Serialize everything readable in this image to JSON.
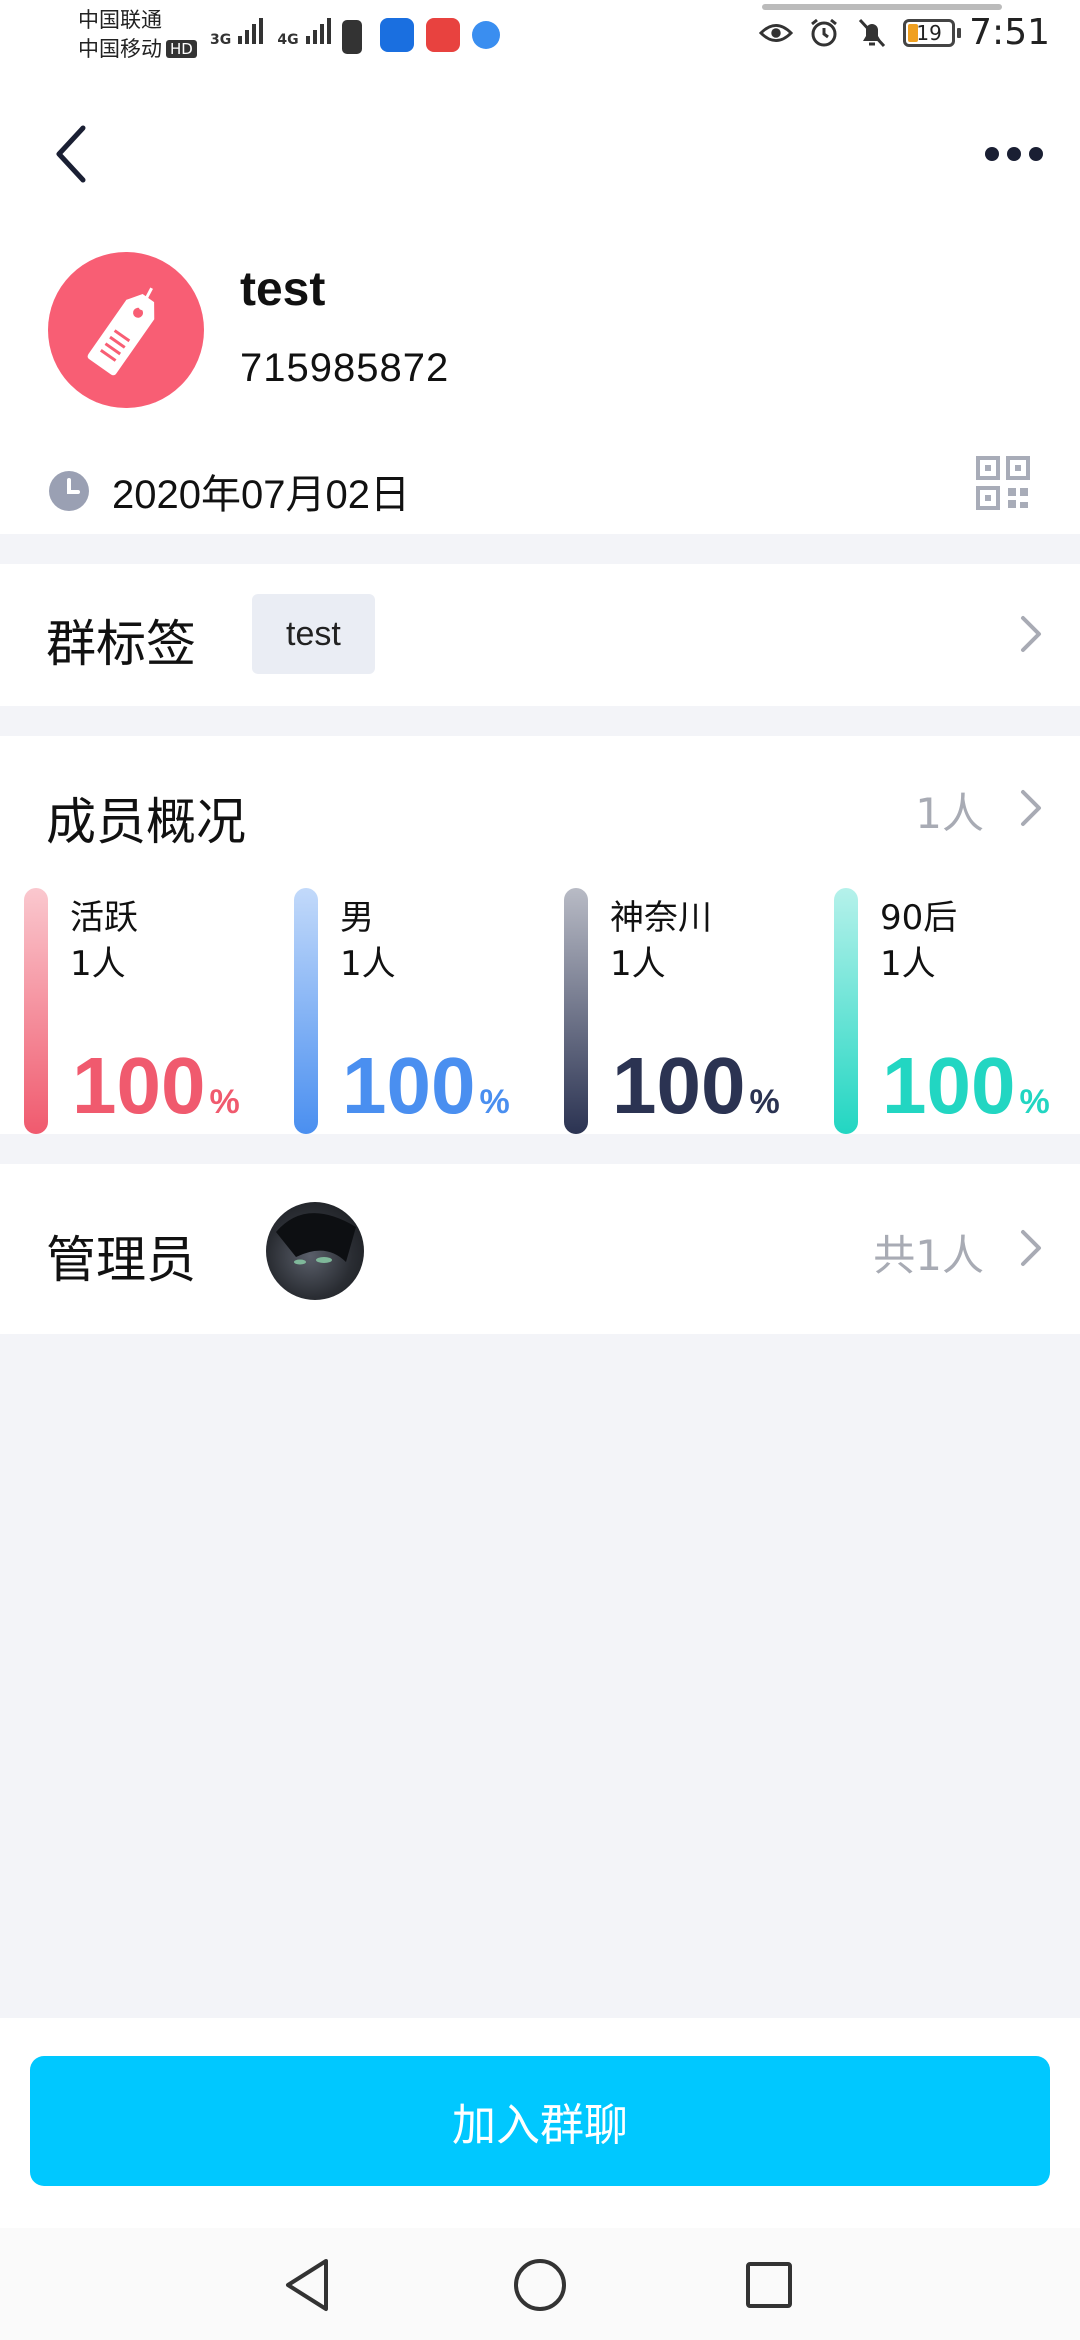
{
  "status_bar": {
    "carrier_1": "中国联通",
    "carrier_2": "中国移动",
    "hd": "HD",
    "net_1": "3G",
    "net_2": "4G",
    "battery": "19",
    "time": "7:51"
  },
  "header": {
    "group_name": "test",
    "group_id": "715985872",
    "created_date": "2020年07月02日",
    "avatar_icon": "price-tag-icon",
    "avatar_color": "#f85e74"
  },
  "tag_row": {
    "label": "群标签",
    "tag": "test"
  },
  "members": {
    "label": "成员概况",
    "count": "1人",
    "stats": [
      {
        "label": "活跃",
        "count": "1人",
        "percent": "100",
        "unit": "%",
        "color": "#f05a6e"
      },
      {
        "label": "男",
        "count": "1人",
        "percent": "100",
        "unit": "%",
        "color": "#4a8ff0"
      },
      {
        "label": "神奈川",
        "count": "1人",
        "percent": "100",
        "unit": "%",
        "color": "#2b3352"
      },
      {
        "label": "90后",
        "count": "1人",
        "percent": "100",
        "unit": "%",
        "color": "#22d6c2"
      }
    ]
  },
  "admins": {
    "label": "管理员",
    "count": "共1人"
  },
  "join_button": {
    "label": "加入群聊",
    "color": "#00c8ff"
  }
}
